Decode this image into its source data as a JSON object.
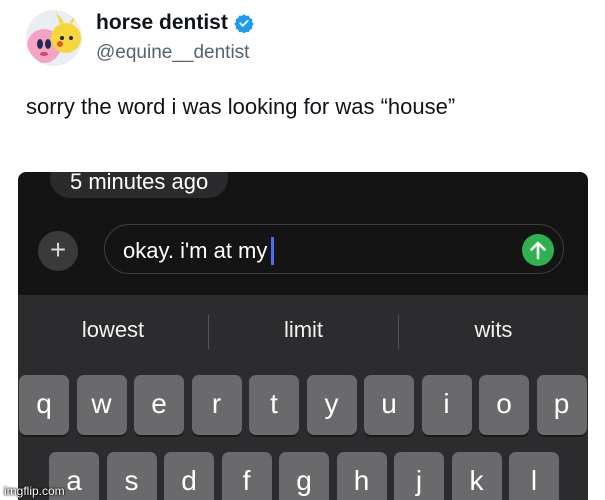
{
  "tweet": {
    "display_name": "horse dentist",
    "handle": "@equine__dentist",
    "text": "sorry the word i was looking for was “house”",
    "verified_color": "#1d9bf0"
  },
  "screenshot": {
    "previous_message_time": "5 minutes ago",
    "input_text": "okay. i'm at my",
    "send_button_color": "#30b150",
    "predictive_suggestions": [
      "lowest",
      "limit",
      "wits"
    ],
    "keyboard_row_1": [
      "q",
      "w",
      "e",
      "r",
      "t",
      "y",
      "u",
      "i",
      "o",
      "p"
    ],
    "keyboard_row_2": [
      "a",
      "s",
      "d",
      "f",
      "g",
      "h",
      "j",
      "k",
      "l"
    ]
  },
  "watermark": "imgflip.com"
}
